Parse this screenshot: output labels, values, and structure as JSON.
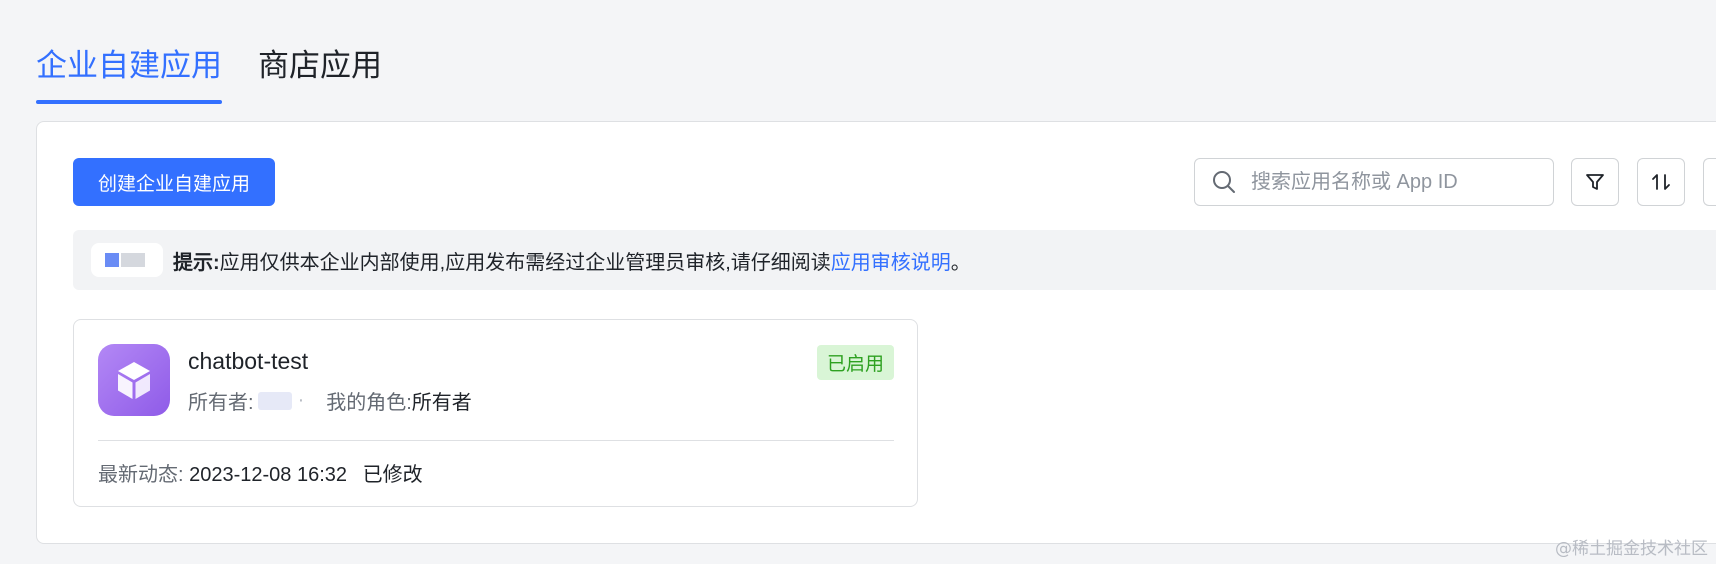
{
  "tabs": [
    {
      "label": "企业自建应用",
      "active": true
    },
    {
      "label": "商店应用",
      "active": false
    }
  ],
  "toolbar": {
    "create_label": "创建企业自建应用",
    "search_placeholder": "搜索应用名称或 App ID",
    "filter_icon": "filter-icon",
    "sort_icon": "sort-icon"
  },
  "notice": {
    "label": "提示:",
    "text": "应用仅供本企业内部使用,应用发布需经过企业管理员审核,请仔细阅读 ",
    "link": "应用审核说明",
    "end": "。"
  },
  "app": {
    "name": "chatbot-test",
    "owner_label": "所有者:",
    "role_label": "我的角色:",
    "role_value": "所有者",
    "status": "已启用",
    "latest_label": "最新动态:",
    "latest_time": "2023-12-08 16:32",
    "latest_action": "已修改"
  },
  "watermark": "@稀土掘金技术社区",
  "colors": {
    "accent": "#3370ff",
    "status_bg": "#d9f5d6",
    "status_text": "#2ea121",
    "icon_purple": "#9b6bef"
  }
}
